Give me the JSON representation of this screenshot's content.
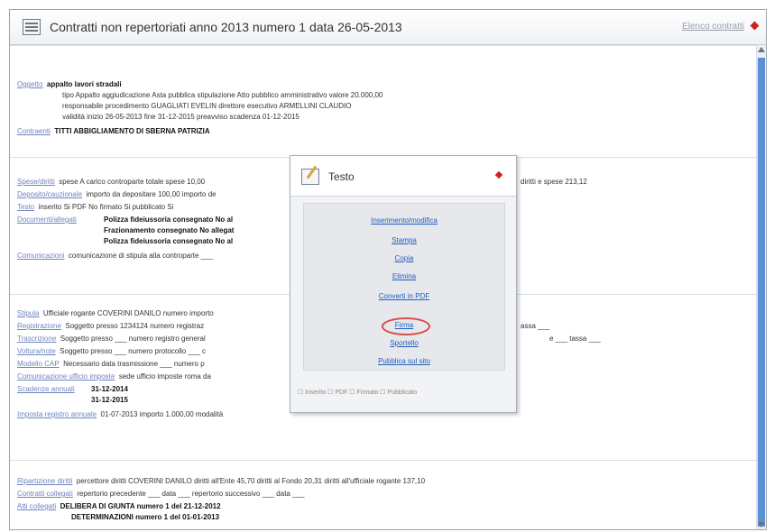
{
  "header": {
    "title": "Contratti non repertoriati anno 2013 numero 1 data 26-05-2013",
    "help_link": "Elenco contratti"
  },
  "sec1": {
    "oggetto_label": "Oggetto",
    "oggetto_value": "appalto lavori stradali",
    "r2": "tipo Appalto aggiudicazione Asta pubblica stipulazione Atto pubblico amministrativo valore 20.000,00",
    "r3": "responsabile procedimento GUAGLIATI EVELIN direttore esecutivo ARMELLINI CLAUDIO",
    "r4": "validità inizio 26-05-2013 fine 31-12-2015 preavviso scadenza 01-12-2015",
    "contraenti_label": "Contraenti",
    "contraenti_value": "TITTI ABBIGLIAMENTO DI SBERNA PATRIZIA"
  },
  "sec2": {
    "spese_label": "Spese/diritti",
    "spese_text": "spese A carico controparte totale spese 10,00",
    "spese_right": "diritti e spese 213,12",
    "deposito_label": "Deposito/cauzionale",
    "deposito_text": "importo da depositare 100,00 importo de",
    "testo_label": "Testo",
    "testo_text": "inserito Si PDF No firmato Si pubblicato Si",
    "documenti_label": "Documenti/allegati",
    "doc1": "Polizza fideiussoria consegnato No al",
    "doc2": "Frazionamento consegnato No allegat",
    "doc3": "Polizza fideiussoria consegnato No al",
    "comunicazioni_label": "Comunicazioni",
    "comunicazioni_text": "comunicazione di stipula alla controparte ___"
  },
  "sec3": {
    "stipula_label": "Stipula",
    "stipula_text": "Ufficiale rogante COVERINI DANILO numero importo",
    "registrazione_label": "Registrazione",
    "registrazione_text": "Soggetto presso 1234124 numero registraz",
    "registrazione_right": "assa ___",
    "trascrizione_label": "Trascrizione",
    "trascrizione_text": "Soggetto presso ___ numero registro general",
    "trascrizione_right": "e ___ tassa ___",
    "voltura_label": "Voltura/note",
    "voltura_text": "Soggetto presso ___ numero protocollo ___ c",
    "modello_label": "Modello CAP",
    "modello_text": "Necessario data trasmissione ___ numero p",
    "comuff_label": "Comunicazione ufficio imposte",
    "comuff_text": "sede ufficio imposte roma da",
    "scadenze_label": "Scadenze annuali",
    "scad1": "31-12-2014",
    "scad2": "31-12-2015",
    "imposta_label": "Imposta registro annuale",
    "imposta_text": "01-07-2013 importo 1.000,00 modalità"
  },
  "sec4": {
    "ripartizione_label": "Ripartizione diritti",
    "ripartizione_text": "percettore diritti COVERINI DANILO diritti all'Ente 45,70 diritti al Fondo 20,31 diritti all'ufficiale rogante 137,10",
    "collegati_label": "Contratti collegati",
    "collegati_text": "repertorio precedente ___ data ___ repertorio successivo ___ data ___",
    "atti_label": "Atti collegati",
    "atto1": "DELIBERA DI GIUNTA numero 1 del 21-12-2012",
    "atto2": "DETERMINAZIONI numero 1 del 01-01-2013"
  },
  "popup": {
    "title": "Testo",
    "links": [
      "Inserimento/modifica",
      "Stampa",
      "Copia",
      "Elimina",
      "Converti in PDF",
      "Firma",
      "Sportello",
      "Pubblica sul sito"
    ],
    "footer": "☐ Inserito ☐ PDF ☐ Firmato ☐ Pubblicato"
  }
}
